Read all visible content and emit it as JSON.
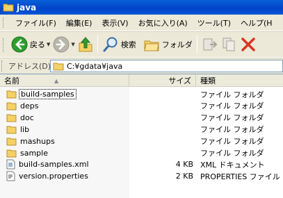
{
  "window": {
    "title": "java"
  },
  "menu": [
    {
      "label": "ファイル(F)"
    },
    {
      "label": "編集(E)"
    },
    {
      "label": "表示(V)"
    },
    {
      "label": "お気に入り(A)"
    },
    {
      "label": "ツール(T)"
    },
    {
      "label": "ヘルプ(H"
    }
  ],
  "toolbar": {
    "back_label": "戻る",
    "search_label": "検索",
    "folders_label": "フォルダ"
  },
  "address": {
    "label": "アドレス(D)",
    "value": "C:¥gdata¥java"
  },
  "columns": {
    "name": "名前",
    "size": "サイズ",
    "type": "種類"
  },
  "files": [
    {
      "name": "build-samples",
      "size": "",
      "type": "ファイル フォルダ",
      "icon": "folder-icon"
    },
    {
      "name": "deps",
      "size": "",
      "type": "ファイル フォルダ",
      "icon": "folder-icon"
    },
    {
      "name": "doc",
      "size": "",
      "type": "ファイル フォルダ",
      "icon": "folder-icon"
    },
    {
      "name": "lib",
      "size": "",
      "type": "ファイル フォルダ",
      "icon": "folder-icon"
    },
    {
      "name": "mashups",
      "size": "",
      "type": "ファイル フォルダ",
      "icon": "folder-icon"
    },
    {
      "name": "sample",
      "size": "",
      "type": "ファイル フォルダ",
      "icon": "folder-icon"
    },
    {
      "name": "build-samples.xml",
      "size": "4 KB",
      "type": "XML ドキュメント",
      "icon": "xml-file-icon"
    },
    {
      "name": "version.properties",
      "size": "2 KB",
      "type": "PROPERTIES ファイル",
      "icon": "text-file-icon"
    }
  ],
  "colors": {
    "titlebar": "#0a57d4",
    "folder": "#f5d166",
    "address_border": "#7f9db9",
    "back_green": "#2e9d2e",
    "close_red": "#d9341f"
  }
}
